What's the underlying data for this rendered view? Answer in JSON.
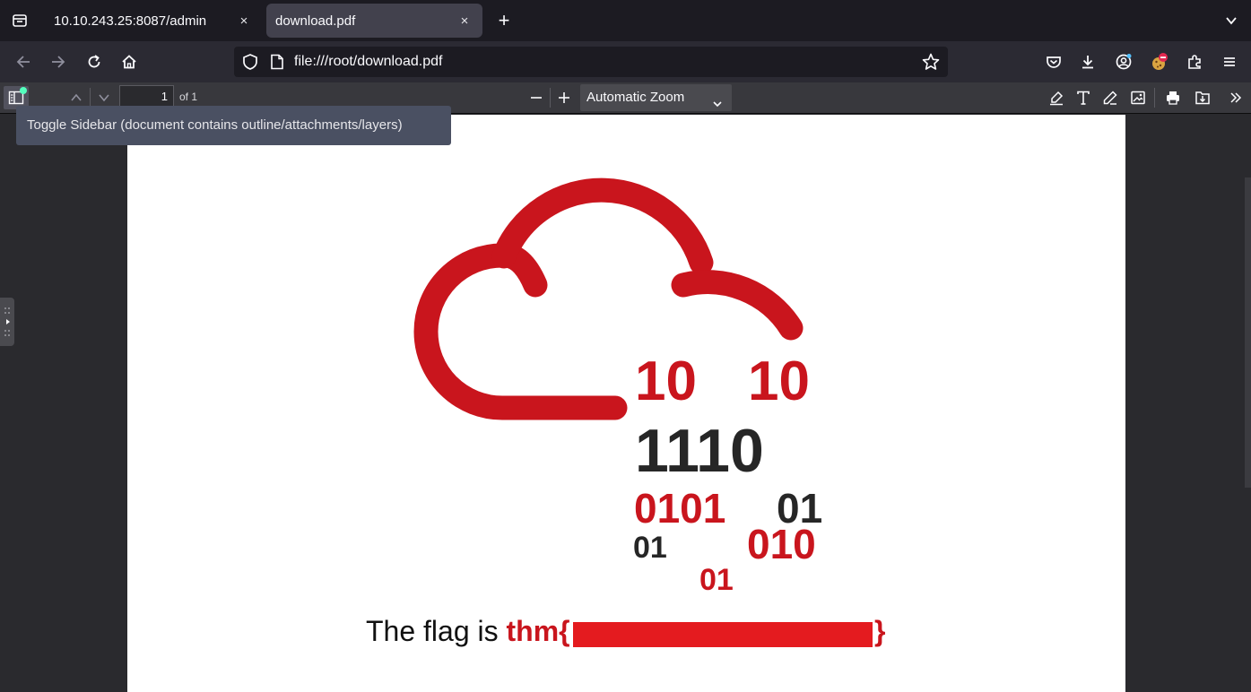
{
  "tabs": [
    {
      "title": "10.10.243.25:8087/admin",
      "close": "×"
    },
    {
      "title": "download.pdf",
      "close": "×"
    }
  ],
  "new_tab_label": "+",
  "url": "file:///root/download.pdf",
  "pdf_toolbar": {
    "page_number": "1",
    "page_count": "of 1",
    "zoom": "Automatic Zoom"
  },
  "tooltip": "Toggle Sidebar (document contains outline/attachments/layers)",
  "document": {
    "binary": [
      "10",
      "10",
      "1110",
      "0101",
      "01",
      "01",
      "010",
      "01"
    ],
    "flag_prefix": "The flag is ",
    "flag_open": "thm{",
    "flag_close": "}"
  },
  "colors": {
    "accent_red": "#c9151d",
    "dark_digits": "#262626"
  }
}
